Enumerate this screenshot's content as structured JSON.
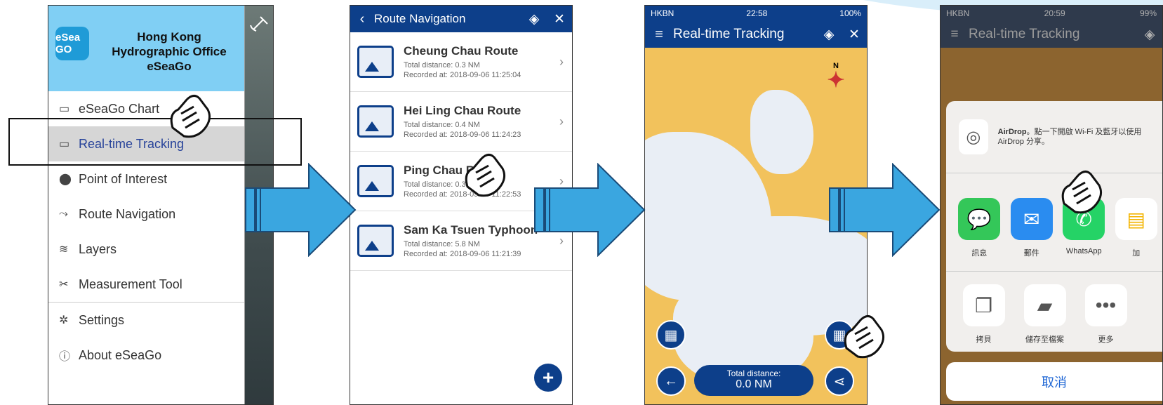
{
  "panel1": {
    "org_line1": "Hong Kong",
    "org_line2": "Hydrographic Office",
    "app_name": "eSeaGo",
    "logo_text": "eSea GO",
    "menu": [
      {
        "label": "eSeaGo Chart",
        "icon": "chart-icon"
      },
      {
        "label": "Real-time Tracking",
        "icon": "tracking-icon",
        "active": true
      },
      {
        "label": "Point of Interest",
        "icon": "map-pin-icon"
      },
      {
        "label": "Route Navigation",
        "icon": "route-icon"
      },
      {
        "label": "Layers",
        "icon": "layers-icon"
      },
      {
        "label": "Measurement Tool",
        "icon": "measure-icon"
      },
      {
        "label": "Settings",
        "icon": "gear-icon"
      },
      {
        "label": "About eSeaGo",
        "icon": "info-icon"
      }
    ]
  },
  "panel2": {
    "title": "Route Navigation",
    "routes": [
      {
        "name": "Cheung Chau Route",
        "distance": "Total distance: 0.3 NM",
        "recorded": "Recorded at: 2018-09-06 11:25:04"
      },
      {
        "name": "Hei Ling Chau Route",
        "distance": "Total distance: 0.4 NM",
        "recorded": "Recorded at: 2018-09-06 11:24:23"
      },
      {
        "name": "Ping Chau Route",
        "distance": "Total distance: 0.3 NM",
        "recorded": "Recorded at: 2018-09-06 11:22:53"
      },
      {
        "name": "Sam Ka Tsuen Typhoon",
        "distance": "Total distance: 5.8 NM",
        "recorded": "Recorded at: 2018-09-06 11:21:39"
      }
    ],
    "add_label": "+"
  },
  "panel3": {
    "carrier": "HKBN",
    "time": "22:58",
    "battery": "100%",
    "title": "Real-time Tracking",
    "compass_n": "N",
    "dist_label": "Total distance:",
    "dist_value": "0.0 NM"
  },
  "panel4": {
    "carrier": "HKBN",
    "time": "20:59",
    "battery": "99%",
    "title": "Real-time Tracking",
    "airdrop_title": "AirDrop",
    "airdrop_text": "。點一下開啟 Wi-Fi 及藍牙以使用 AirDrop 分享。",
    "apps": [
      {
        "label": "訊息",
        "color": "#34c759",
        "icon": "message-icon"
      },
      {
        "label": "郵件",
        "color": "#2a8cf0",
        "icon": "mail-icon"
      },
      {
        "label": "WhatsApp",
        "color": "#25d366",
        "icon": "whatsapp-icon"
      },
      {
        "label": "加",
        "color": "#ffffff",
        "icon": "notes-icon"
      }
    ],
    "actions": [
      {
        "label": "拷貝",
        "icon": "copy-icon"
      },
      {
        "label": "儲存至檔案",
        "icon": "folder-icon"
      },
      {
        "label": "更多",
        "icon": "more-icon"
      }
    ],
    "cancel": "取消"
  },
  "colors": {
    "navy": "#0d3f8a",
    "arrow": "#3aa6e0",
    "drawer_header": "#80cff4",
    "map_land": "#f2c25c"
  }
}
